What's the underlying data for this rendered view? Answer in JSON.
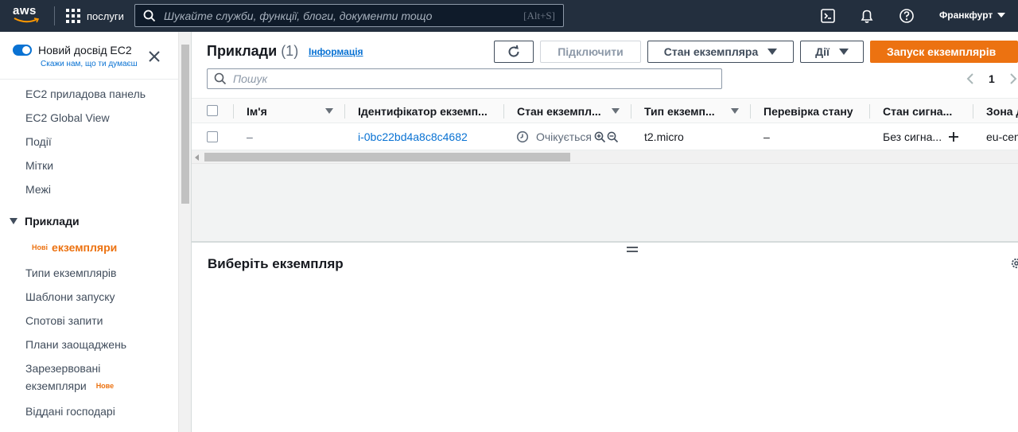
{
  "topnav": {
    "logo_text": "aws",
    "services_label": "послуги",
    "search_placeholder": "Шукайте служби, функції, блоги, документи тощо",
    "search_shortcut": "[Alt+S]",
    "region_label": "Франкфурт",
    "icons": [
      "cloudshell-icon",
      "notifications-bell-icon",
      "help-icon"
    ]
  },
  "sidebar": {
    "new_experience_title": "Новий досвід EC2",
    "new_experience_feedback": "Скажи нам, що ти думаєш",
    "items": [
      {
        "label": "EC2 приладова панель"
      },
      {
        "label": "EC2 Global View"
      },
      {
        "label": "Події"
      },
      {
        "label": "Мітки"
      },
      {
        "label": "Межі"
      }
    ],
    "section_label": "Приклади",
    "section_items": [
      {
        "badge": "Нові",
        "label": "екземпляри",
        "active": true
      },
      {
        "label": "Типи екземплярів"
      },
      {
        "label": "Шаблони запуску"
      },
      {
        "label": "Спотові запити"
      },
      {
        "label": "Плани заощаджень"
      },
      {
        "label_line1": "Зарезервовані",
        "label_line2": "екземпляри",
        "badge": "Нове"
      },
      {
        "label": "Віддані господарі"
      }
    ]
  },
  "header": {
    "title": "Приклади",
    "count": "(1)",
    "info_link": "Інформація",
    "connect_label": "Підключити",
    "instance_state_label": "Стан екземпляра",
    "actions_label": "Дії",
    "launch_label": "Запуск екземплярів"
  },
  "filter": {
    "placeholder": "Пошук"
  },
  "pagination": {
    "current_page": "1"
  },
  "table": {
    "columns": [
      "Ім'я",
      "Ідентифікатор екземп...",
      "Стан екземпл...",
      "Тип екземп...",
      "Перевірка стану",
      "Стан сигна...",
      "Зона д"
    ],
    "rows": [
      {
        "name": "–",
        "instance_id": "i-0bc22bd4a8c8c4682",
        "state": "Очікується",
        "type": "t2.micro",
        "status_check": "–",
        "alarm_status": "Без сигна...",
        "zone": "eu-cen"
      }
    ]
  },
  "detail": {
    "title": "Виберіть екземпляр"
  },
  "colors": {
    "nav_bg": "#232f3e",
    "primary": "#ec7211",
    "link": "#0972d3"
  }
}
